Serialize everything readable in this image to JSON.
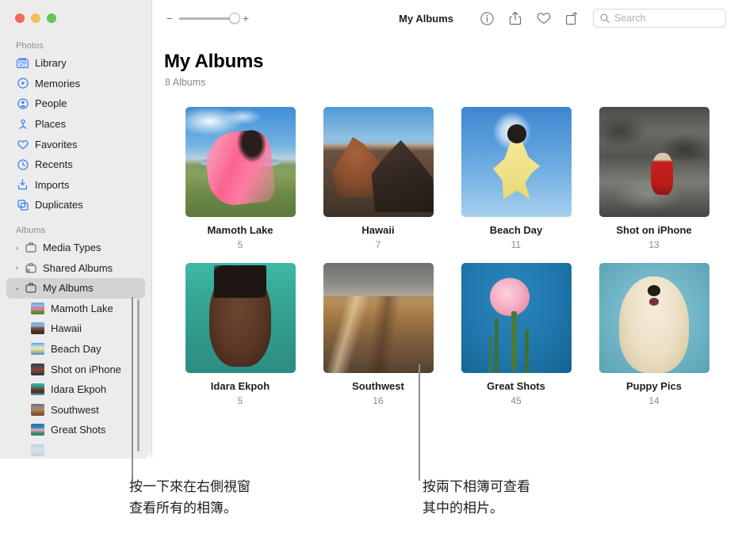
{
  "window": {
    "traffic_lights": [
      "close",
      "minimize",
      "zoom"
    ]
  },
  "toolbar": {
    "zoom_minus": "−",
    "zoom_plus": "+",
    "title": "My Albums",
    "buttons": [
      {
        "name": "info-icon",
        "label": "Info"
      },
      {
        "name": "share-icon",
        "label": "Share"
      },
      {
        "name": "favorite-heart-icon",
        "label": "Favorite"
      },
      {
        "name": "rotate-icon",
        "label": "Rotate"
      }
    ],
    "search_placeholder": "Search"
  },
  "sidebar": {
    "photos_section_label": "Photos",
    "photos_items": [
      {
        "label": "Library",
        "icon": "library-icon"
      },
      {
        "label": "Memories",
        "icon": "memories-icon"
      },
      {
        "label": "People",
        "icon": "people-icon"
      },
      {
        "label": "Places",
        "icon": "places-icon"
      },
      {
        "label": "Favorites",
        "icon": "heart-icon"
      },
      {
        "label": "Recents",
        "icon": "clock-icon"
      },
      {
        "label": "Imports",
        "icon": "imports-icon"
      },
      {
        "label": "Duplicates",
        "icon": "duplicates-icon"
      }
    ],
    "albums_section_label": "Albums",
    "album_groups": [
      {
        "label": "Media Types",
        "expanded": false,
        "chevron": "›"
      },
      {
        "label": "Shared Albums",
        "expanded": false,
        "chevron": "›"
      },
      {
        "label": "My Albums",
        "expanded": true,
        "chevron": "⌄",
        "selected": true
      }
    ],
    "album_children": [
      {
        "label": "Mamoth Lake",
        "thumb": "t-mamoth"
      },
      {
        "label": "Hawaii",
        "thumb": "t-hawaii"
      },
      {
        "label": "Beach Day",
        "thumb": "t-beach"
      },
      {
        "label": "Shot on iPhone",
        "thumb": "t-shot"
      },
      {
        "label": "Idara Ekpoh",
        "thumb": "t-idara"
      },
      {
        "label": "Southwest",
        "thumb": "t-south"
      },
      {
        "label": "Great Shots",
        "thumb": "t-great"
      }
    ]
  },
  "content": {
    "title": "My Albums",
    "subtitle": "8 Albums",
    "albums": [
      {
        "name": "Mamoth Lake",
        "count": "5",
        "art": "ph-mamoth"
      },
      {
        "name": "Hawaii",
        "count": "7",
        "art": "ph-hawaii"
      },
      {
        "name": "Beach Day",
        "count": "11",
        "art": "ph-beach"
      },
      {
        "name": "Shot on iPhone",
        "count": "13",
        "art": "ph-shot"
      },
      {
        "name": "Idara Ekpoh",
        "count": "5",
        "art": "ph-idara"
      },
      {
        "name": "Southwest",
        "count": "16",
        "art": "ph-south"
      },
      {
        "name": "Great Shots",
        "count": "45",
        "art": "ph-great"
      },
      {
        "name": "Puppy Pics",
        "count": "14",
        "art": "ph-puppy"
      }
    ]
  },
  "callouts": [
    {
      "name": "callout-sidebar",
      "text": "按一下來在右側視窗\n查看所有的相簿。"
    },
    {
      "name": "callout-album",
      "text": "按兩下相簿可查看\n其中的相片。"
    }
  ]
}
